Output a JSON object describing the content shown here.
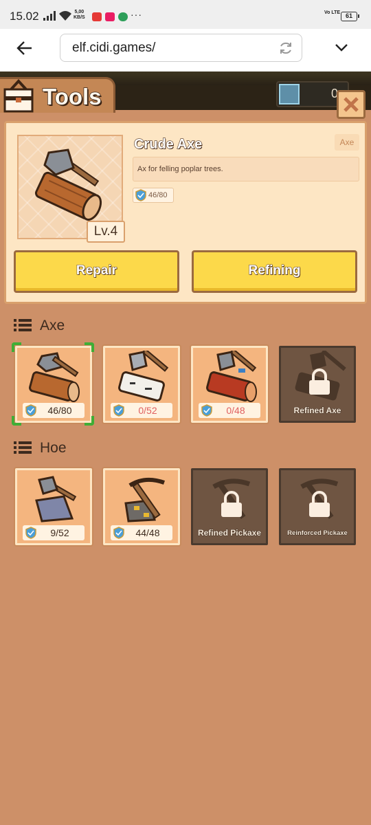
{
  "status_bar": {
    "time": "15.02",
    "speed_value": "5,00",
    "speed_unit": "KB/S",
    "battery": "61",
    "volte": "Vo LTE",
    "more": "···"
  },
  "browser": {
    "url": "elf.cidi.games/"
  },
  "header": {
    "title": "Tools",
    "gem_count": "0"
  },
  "detail": {
    "name": "Crude Axe",
    "type": "Axe",
    "description": "Ax for felling poplar trees.",
    "durability": "46/80",
    "level": "Lv.4",
    "repair_label": "Repair",
    "refining_label": "Refining"
  },
  "sections": {
    "axe": {
      "title": "Axe",
      "items": [
        {
          "durability": "46/80",
          "selected": true,
          "locked": false
        },
        {
          "durability": "0/52",
          "selected": false,
          "locked": false
        },
        {
          "durability": "0/48",
          "selected": false,
          "locked": false
        },
        {
          "name": "Refined Axe",
          "locked": true
        }
      ]
    },
    "hoe": {
      "title": "Hoe",
      "items": [
        {
          "durability": "9/52",
          "locked": false
        },
        {
          "durability": "44/48",
          "locked": false
        },
        {
          "name": "Refined Pickaxe",
          "locked": true
        },
        {
          "name": "Reinforced Pickaxe",
          "locked": true
        }
      ]
    }
  },
  "colors": {
    "background": "#cd9068",
    "button_yellow": "#fcd94a",
    "durability_low": "#e06060",
    "durability_ok": "#3c2a1e"
  }
}
